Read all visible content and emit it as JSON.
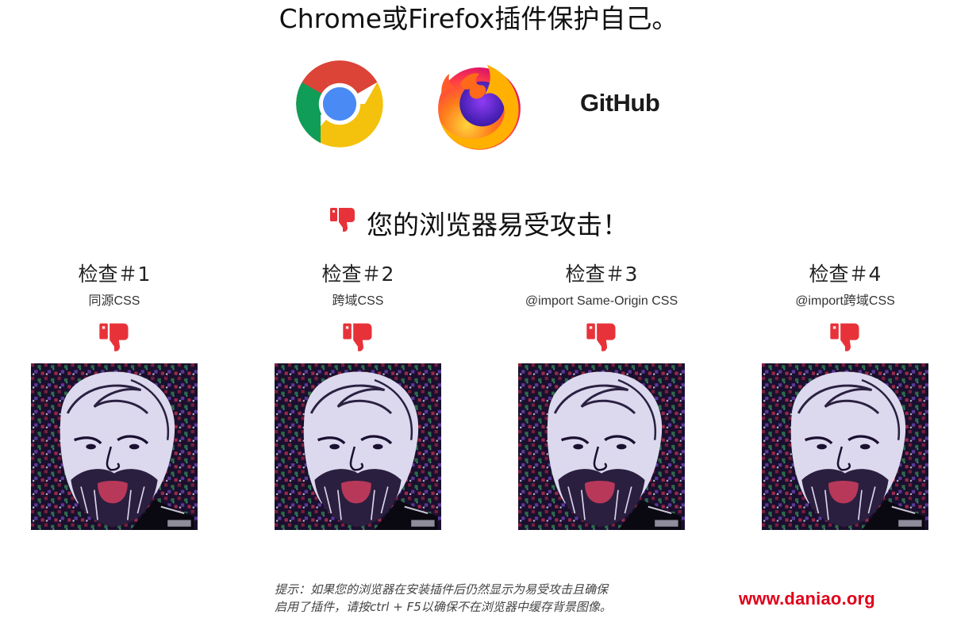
{
  "header": {
    "text": "Chrome或Firefox插件保护自己。"
  },
  "logos": {
    "chrome": "chrome-logo",
    "firefox": "firefox-logo",
    "github": "GitHub"
  },
  "result": {
    "icon": "thumbs-down-icon",
    "text": "您的浏览器易受攻击！"
  },
  "checks": [
    {
      "title": "检查＃1",
      "subtitle": "同源CSS"
    },
    {
      "title": "检查＃2",
      "subtitle": "跨域CSS"
    },
    {
      "title": "检查＃3",
      "subtitle": "@import Same-Origin CSS"
    },
    {
      "title": "检查＃4",
      "subtitle": "@import跨域CSS"
    }
  ],
  "hint": {
    "line1": "提示：如果您的浏览器在安装插件后仍然显示为易受攻击且确保",
    "line2": "启用了插件，请按ctrl + F5以确保不在浏览器中缓存背景图像。"
  },
  "watermark": "www.daniao.org",
  "colors": {
    "thumb": "#e8323a",
    "watermark": "#e0001a"
  }
}
